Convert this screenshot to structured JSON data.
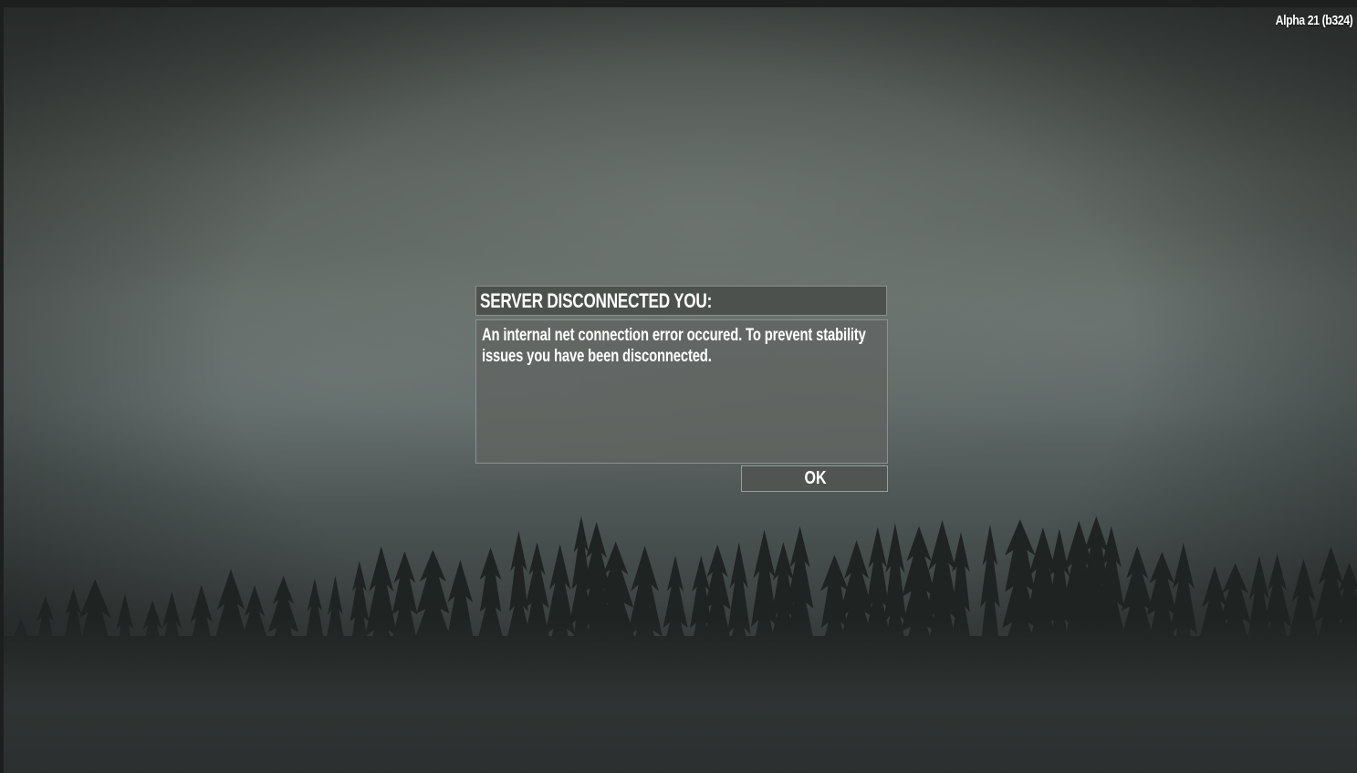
{
  "version_label": "Alpha 21 (b324)",
  "dialog": {
    "title": "SERVER DISCONNECTED YOU:",
    "message": "An internal net connection error occured. To prevent stability issues you have been disconnected.",
    "ok_label": "OK"
  },
  "colors": {
    "sky": "#5f6866",
    "tree_silhouette": "#1f2322",
    "dialog_panel": "#606462",
    "dialog_border": "#8d918f",
    "text": "#ffffff"
  }
}
